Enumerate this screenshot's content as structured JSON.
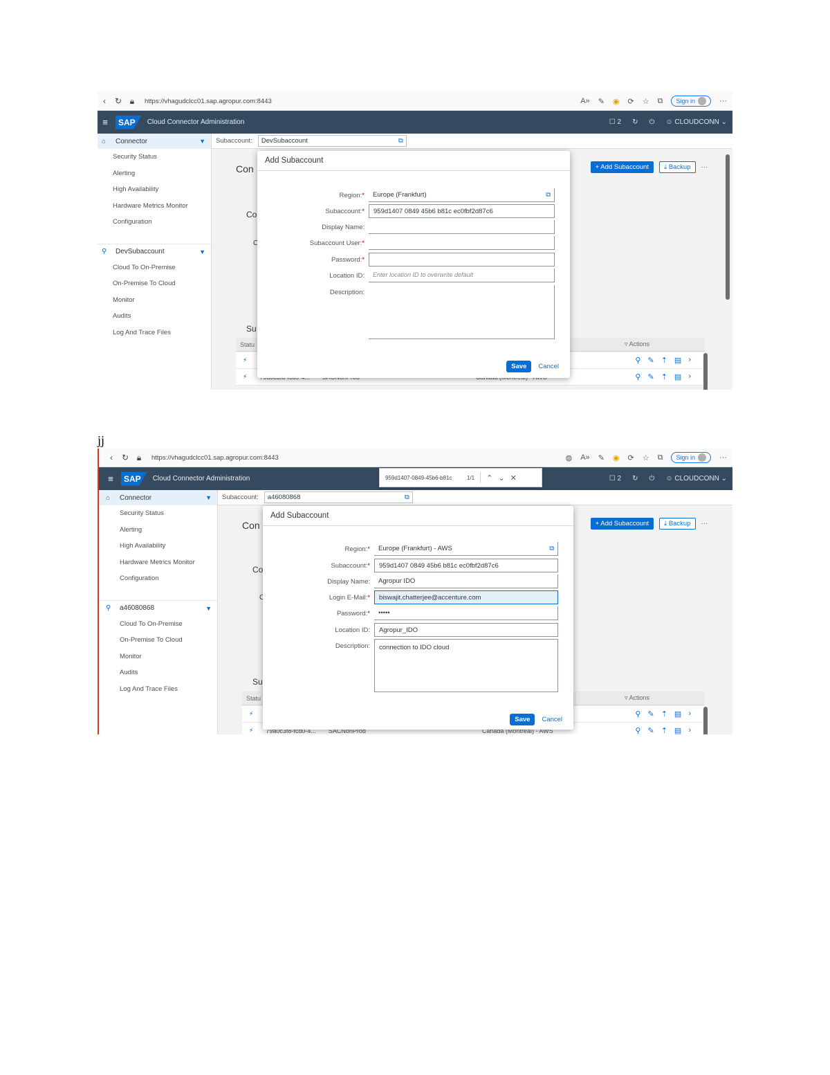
{
  "doc": {
    "between_note": "jj"
  },
  "shot1": {
    "browser": {
      "url": "https://vhagudclcc01.sap.agropur.com:8443",
      "signin": "Sign in"
    },
    "header": {
      "logo": "SAP",
      "title": "Cloud Connector Administration",
      "notif": "2",
      "user": "CLOUDCONN"
    },
    "nav": {
      "group1": "Connector",
      "group1_items": [
        "Security Status",
        "Alerting",
        "High Availability",
        "Hardware Metrics Monitor",
        "Configuration"
      ],
      "group2": "DevSubaccount",
      "group2_items": [
        "Cloud To On-Premise",
        "On-Premise To Cloud",
        "Monitor",
        "Audits",
        "Log And Trace Files"
      ]
    },
    "main": {
      "subaccount_label": "Subaccount:",
      "subaccount_value": "DevSubaccount",
      "page_title": "Con",
      "add_button": "Add Subaccount",
      "backup_button": "Backup",
      "more": "···",
      "sec1": "Co",
      "sec2": "C",
      "sec3": "Su",
      "col_status": "Statu",
      "col_actions": "Actions",
      "row2": [
        "79a0c3f8-fcd0-4...",
        "SACNonProd",
        "Canada (Montreal) - AWS"
      ]
    },
    "dialog": {
      "title": "Add Subaccount",
      "region_label": "Region:",
      "region_value": "Europe (Frankfurt)",
      "subaccount_label": "Subaccount:",
      "subaccount_value": "959d1407 0849 45b6 b81c ec0fbf2d87c6",
      "display_label": "Display Name:",
      "display_value": "",
      "user_label": "Subaccount User:",
      "user_value": "",
      "password_label": "Password:",
      "password_value": "",
      "location_label": "Location ID:",
      "location_placeholder": "Enter location ID to overwrite default",
      "description_label": "Description:",
      "description_value": "",
      "save": "Save",
      "cancel": "Cancel"
    }
  },
  "shot2": {
    "browser": {
      "url": "https://vhagudclcc01.sap.agropur.com:8443",
      "signin": "Sign in"
    },
    "findbar": {
      "text": "959d1407-0849-45b6-b81c",
      "count": "1/1"
    },
    "header": {
      "logo": "SAP",
      "title": "Cloud Connector Administration",
      "notif": "2",
      "user": "CLOUDCONN"
    },
    "nav": {
      "group1": "Connector",
      "group1_items": [
        "Security Status",
        "Alerting",
        "High Availability",
        "Hardware Metrics Monitor",
        "Configuration"
      ],
      "group2": "a46080868",
      "group2_items": [
        "Cloud To On-Premise",
        "On-Premise To Cloud",
        "Monitor",
        "Audits",
        "Log And Trace Files"
      ]
    },
    "main": {
      "subaccount_label": "Subaccount:",
      "subaccount_value": "a46080868",
      "page_title": "Con",
      "add_button": "Add Subaccount",
      "backup_button": "Backup",
      "more": "···",
      "sec1": "Co",
      "sec2": "C",
      "sec3": "Su",
      "col_status": "Statu",
      "col_actions": "Actions",
      "row2": [
        "79a0c3f8-fcd0-4...",
        "SACNonProd",
        "Canada (Montreal) - AWS"
      ]
    },
    "dialog": {
      "title": "Add Subaccount",
      "region_label": "Region:",
      "region_value": "Europe (Frankfurt) - AWS",
      "subaccount_label": "Subaccount:",
      "subaccount_value": "959d1407 0849 45b6 b81c ec0fbf2d87c6",
      "display_label": "Display Name:",
      "display_value": "Agropur IDO",
      "email_label": "Login E-Mail:",
      "email_value": "biswajit.chatterjee@accenture.com",
      "password_label": "Password:",
      "password_value": "•••••",
      "location_label": "Location ID:",
      "location_value": "Agropur_IDO",
      "description_label": "Description:",
      "description_value": "connection to IDO cloud",
      "save": "Save",
      "cancel": "Cancel"
    }
  }
}
